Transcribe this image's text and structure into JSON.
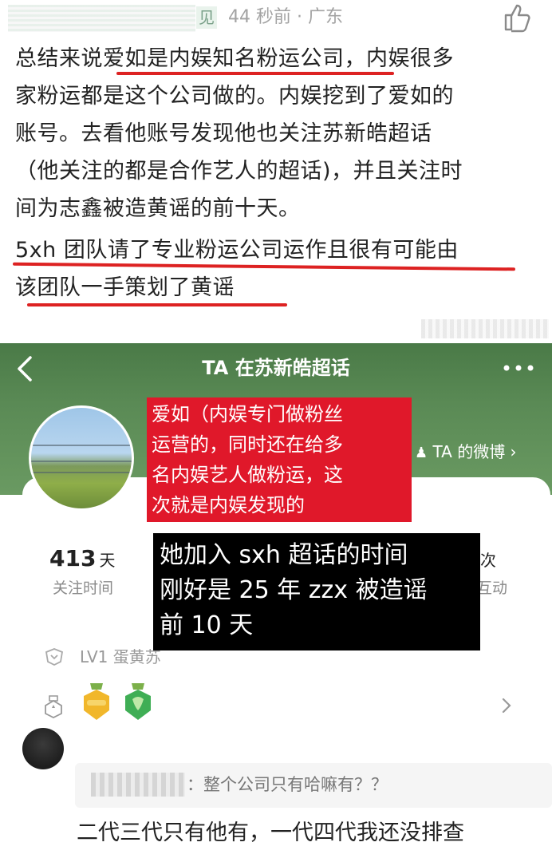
{
  "comment": {
    "location_chip": "见",
    "meta": "44 秒前 · 广东",
    "paragraphs": [
      "总结来说爱如是内娱知名粉运公司，内娱很多",
      "家粉运都是这个公司做的。内娱挖到了爱如的",
      "账号。去看他账号发现他也关注苏新皓超话",
      "（他关注的都是合作艺人的超话)，并且关注时",
      "间为志鑫被造黄谣的前十天。",
      "5xh 团队请了专业粉运公司运作且很有可能由",
      "该团队一手策划了黄谣"
    ]
  },
  "embedded": {
    "title": "TA 在苏新皓超话",
    "weibo_link": "TA 的微博 ›",
    "stats": [
      {
        "value": "413",
        "unit": "天",
        "label": "关注时间"
      },
      {
        "value": "",
        "unit": "次",
        "label": "互动"
      }
    ],
    "level": "LV1 蛋黄苏",
    "colors": {
      "header_green": "#5a8a55",
      "red_overlay": "#e0182a",
      "underline": "#dd2222"
    }
  },
  "overlays": {
    "red": [
      "爱如（内娱专门做粉丝",
      "运营的，同时还在给多",
      "名内娱艺人做粉运，这",
      "次就是内娱发现的"
    ],
    "black": [
      "她加入 sxh 超话的时间",
      "刚好是 25 年 zzx 被造谣",
      "前 10 天"
    ]
  },
  "reply": {
    "quote_user": "",
    "quote_text": "：整个公司只有哈嘛有？？",
    "text": "二代三代只有他有，一代四代我还没排查"
  }
}
